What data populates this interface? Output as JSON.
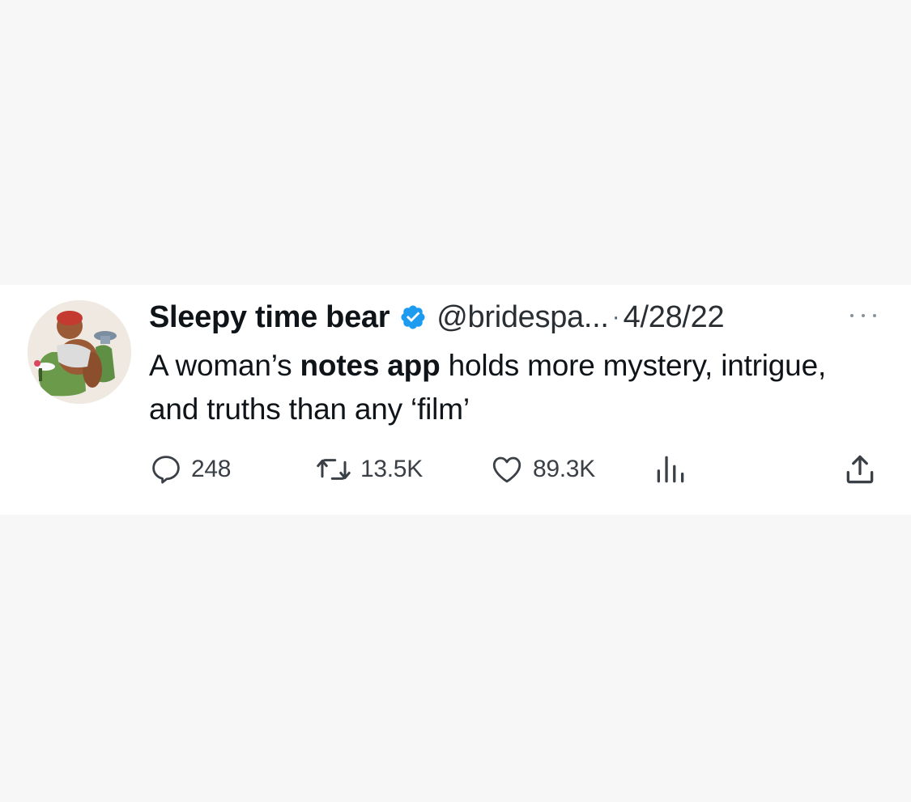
{
  "tweet": {
    "author": {
      "display_name": "Sleepy time bear",
      "handle": "@bridespa...",
      "verified": true,
      "avatar_icon": "avatar-bear-illustration"
    },
    "separator": "·",
    "date": "4/28/22",
    "text": {
      "before": "A woman’s ",
      "bold": "notes app",
      "after": " holds more mystery, intrigue, and truths than any ‘film’"
    },
    "actions": {
      "replies": "248",
      "retweets": "13.5K",
      "likes": "89.3K"
    }
  },
  "colors": {
    "verified_badge": "#1d9bf0",
    "text_primary": "#0f1419",
    "text_secondary": "#536471",
    "background": "#ffffff",
    "page_background": "#f7f7f7"
  },
  "icons": [
    "verified-badge-icon",
    "more-icon",
    "reply-icon",
    "retweet-icon",
    "like-icon",
    "views-icon",
    "share-icon"
  ]
}
